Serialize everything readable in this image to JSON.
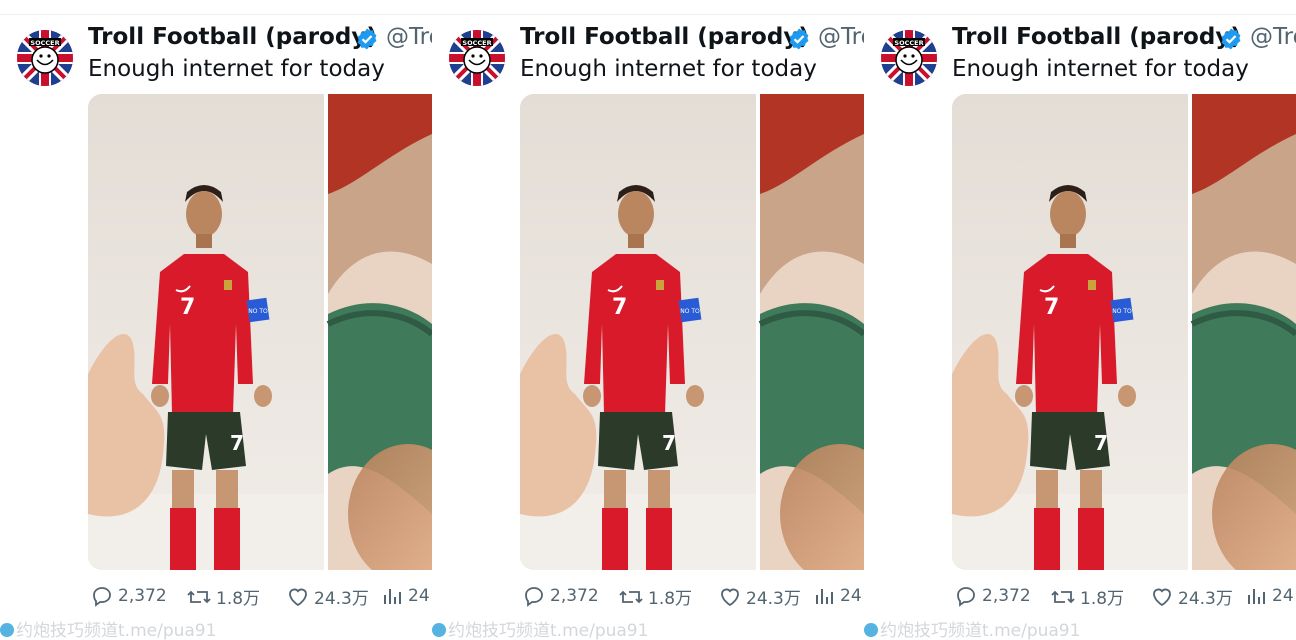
{
  "tweet": {
    "display_name": "Troll Football (parody)",
    "handle": "@Tro",
    "text": "Enough internet for today",
    "avatar_text": "SOCCER",
    "jersey_number": "7",
    "armband_text": "NO TO"
  },
  "actions": {
    "replies": "2,372",
    "retweets": "1.8万",
    "likes": "24.3万",
    "views": "24"
  },
  "watermark": "约炮技巧频道t.me/pua91",
  "colors": {
    "text": "#0f1419",
    "secondary": "#536471",
    "verified": "#1d9bf0",
    "jersey": "#d91a2a",
    "shorts": "#2c3a2a"
  }
}
